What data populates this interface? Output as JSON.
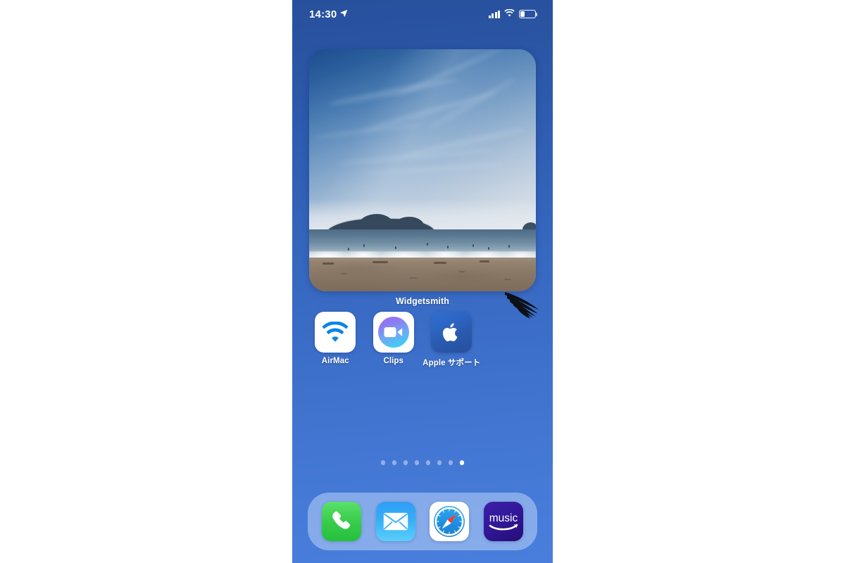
{
  "device": {
    "screen_background_top": "#27509c",
    "screen_background_bottom": "#4a7edc"
  },
  "status_bar": {
    "time": "14:30",
    "location_icon": "location-arrow-icon",
    "cellular_icon": "cellular-signal-icon",
    "cellular_bars": 4,
    "wifi_icon": "wifi-icon",
    "battery_icon": "battery-icon",
    "battery_level_percent": 30
  },
  "widget": {
    "label": "Widgetsmith",
    "kind": "photo-widget",
    "size": "large",
    "photo_description": "beach-sunset-photo",
    "overlay_icon": "bird-wing-icon"
  },
  "app_grid": {
    "apps": [
      {
        "label": "AirMac",
        "icon": "wifi-icon",
        "icon_bg": "#ffffff"
      },
      {
        "label": "Clips",
        "icon": "video-camera-icon",
        "icon_bg": "#ffffff"
      },
      {
        "label": "Apple サポート",
        "icon": "apple-logo-icon",
        "icon_bg": "#2a59ad"
      }
    ]
  },
  "page_dots": {
    "count": 8,
    "active_index": 7
  },
  "dock": {
    "apps": [
      {
        "label": "Phone",
        "icon": "phone-handset-icon",
        "icon_bg": "#30c840"
      },
      {
        "label": "Mail",
        "icon": "envelope-icon",
        "icon_bg": "#35b0f8"
      },
      {
        "label": "Safari",
        "icon": "compass-icon",
        "icon_bg": "#ffffff"
      },
      {
        "label": "Amazon Music",
        "icon": "amazon-music-icon",
        "icon_bg": "#2b1286",
        "wordmark": "music"
      }
    ]
  }
}
